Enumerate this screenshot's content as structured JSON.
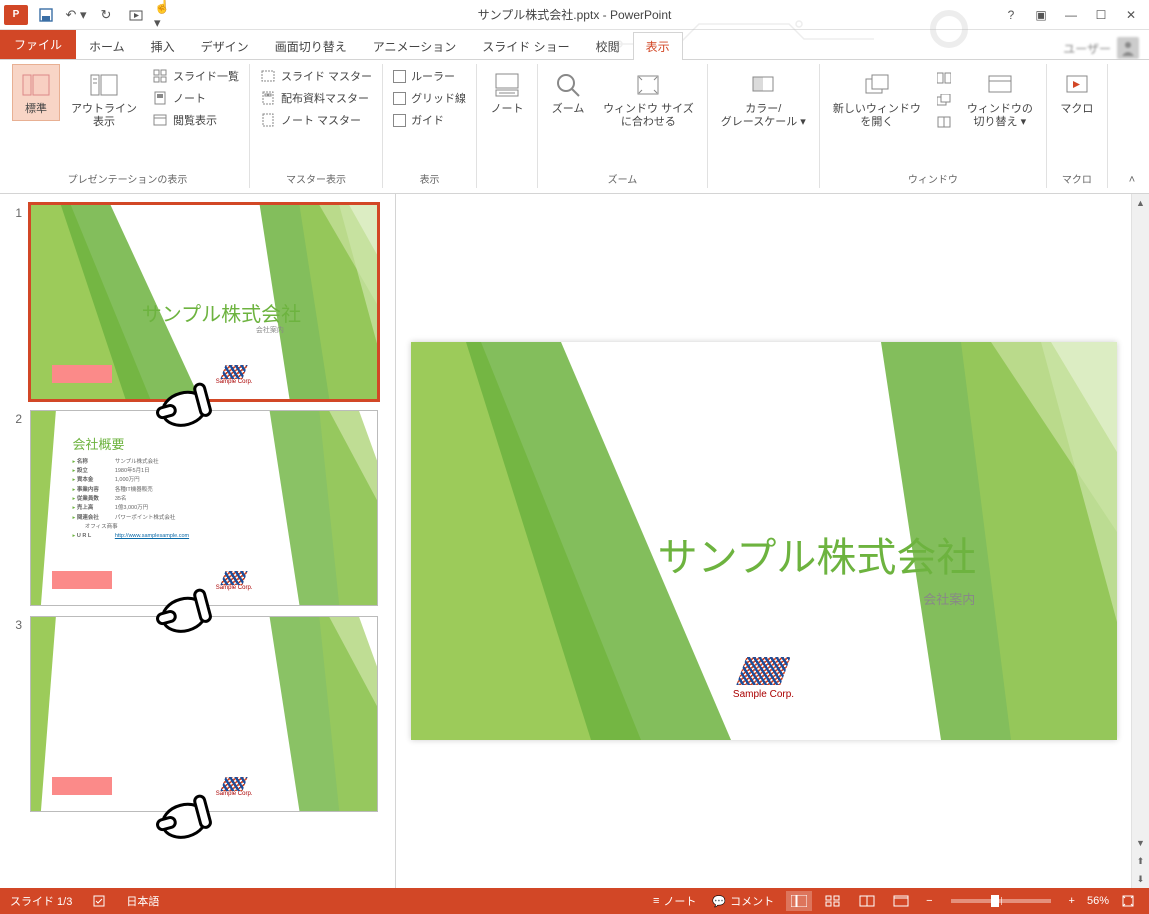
{
  "title": "サンプル株式会社.pptx - PowerPoint",
  "qat": {
    "save": "save-icon",
    "undo": "undo-icon",
    "redo": "redo-icon",
    "start": "start-icon",
    "touch": "touch-icon"
  },
  "win": {
    "help": "?",
    "opts": "▣",
    "min": "—",
    "max": "☐",
    "close": "✕"
  },
  "user": {
    "name": "ユーザー"
  },
  "tabs": {
    "file": "ファイル",
    "items": [
      "ホーム",
      "挿入",
      "デザイン",
      "画面切り替え",
      "アニメーション",
      "スライド ショー",
      "校閲",
      "表示"
    ],
    "active_index": 7
  },
  "ribbon": {
    "groups": {
      "presentation_views": {
        "label": "プレゼンテーションの表示",
        "normal": "標準",
        "outline": "アウトライン\n表示",
        "slide_sorter": "スライド一覧",
        "notes_page": "ノート",
        "reading": "閲覧表示"
      },
      "master_views": {
        "label": "マスター表示",
        "slide_master": "スライド マスター",
        "handout_master": "配布資料マスター",
        "notes_master": "ノート マスター"
      },
      "show": {
        "label": "表示",
        "ruler": "ルーラー",
        "gridlines": "グリッド線",
        "guides": "ガイド"
      },
      "notes": {
        "label": "",
        "notes_btn": "ノート"
      },
      "zoom": {
        "label": "ズーム",
        "zoom_btn": "ズーム",
        "fit": "ウィンドウ サイズ\nに合わせる"
      },
      "color": {
        "label": "",
        "color_gray": "カラー/\nグレースケール ▾"
      },
      "window": {
        "label": "ウィンドウ",
        "new_window": "新しいウィンドウ\nを開く",
        "switch": "ウィンドウの\n切り替え ▾"
      },
      "macro": {
        "label": "マクロ",
        "macro_btn": "マクロ"
      }
    }
  },
  "slides": {
    "list": [
      {
        "num": "1",
        "type": "title",
        "title": "サンプル株式会社",
        "subtitle": "会社案内"
      },
      {
        "num": "2",
        "type": "overview",
        "title": "会社概要",
        "rows": [
          {
            "k": "名称",
            "v": "サンプル株式会社"
          },
          {
            "k": "設立",
            "v": "1980年5月1日"
          },
          {
            "k": "資本金",
            "v": "1,000万円"
          },
          {
            "k": "事業内容",
            "v": "各種IT機器販売"
          },
          {
            "k": "従業員数",
            "v": "35名"
          },
          {
            "k": "売上高",
            "v": "1億3,000万円"
          },
          {
            "k": "関連会社",
            "v": "パワーポイント株式会社\nオフィス商事"
          },
          {
            "k": "U R L",
            "v": "http://www.samplesample.com",
            "url": true
          }
        ]
      },
      {
        "num": "3",
        "type": "blank"
      }
    ],
    "selected": 0
  },
  "main_slide": {
    "title": "サンプル株式会社",
    "subtitle": "会社案内",
    "logo_text": "Sample Corp."
  },
  "statusbar": {
    "slide": "スライド 1/3",
    "lang": "日本語",
    "notes": "ノート",
    "comments": "コメント",
    "zoom": "56%"
  }
}
